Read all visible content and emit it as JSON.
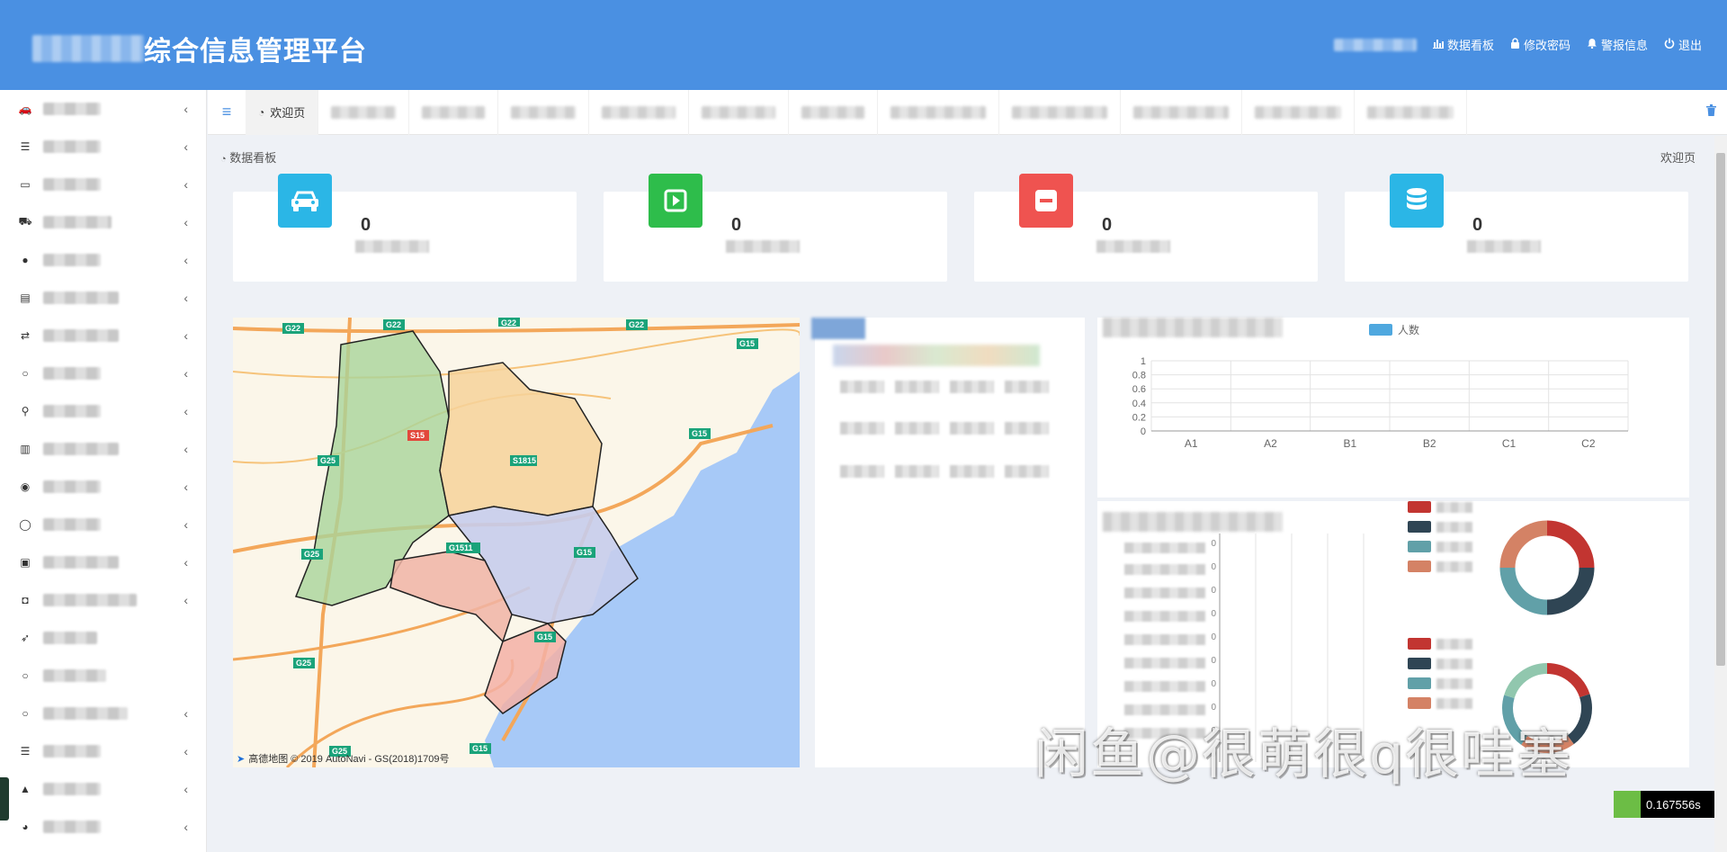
{
  "header": {
    "title": "综合信息管理平台",
    "actions": [
      {
        "label": "数据看板",
        "icon": "bar-chart-icon"
      },
      {
        "label": "修改密码",
        "icon": "lock-icon"
      },
      {
        "label": "警报信息",
        "icon": "bell-icon"
      },
      {
        "label": "退出",
        "icon": "power-icon"
      }
    ]
  },
  "tabs": {
    "active_label": "欢迎页"
  },
  "breadcrumb": {
    "left": "数据看板",
    "right": "欢迎页"
  },
  "stats": [
    {
      "value": "0",
      "icon": "car-icon",
      "color": "#2bb6e6"
    },
    {
      "value": "0",
      "icon": "play-square-icon",
      "color": "#2ebd4b"
    },
    {
      "value": "0",
      "icon": "minus-square-icon",
      "color": "#ef5350"
    },
    {
      "value": "0",
      "icon": "database-icon",
      "color": "#2bb6e6"
    }
  ],
  "map": {
    "credit": "高德地图 © 2019 AutoNavi - GS(2018)1709号",
    "road_labels": [
      "G22",
      "G22",
      "G22",
      "G22",
      "G15",
      "G15",
      "G25",
      "S15",
      "S1815",
      "G1511",
      "G15",
      "G25",
      "G25",
      "G15",
      "G25",
      "G15"
    ]
  },
  "chart_data": {
    "type": "bar",
    "categories": [
      "A1",
      "A2",
      "B1",
      "B2",
      "C1",
      "C2"
    ],
    "series": [
      {
        "name": "人数",
        "values": [
          0,
          0,
          0,
          0,
          0,
          0
        ]
      }
    ],
    "yticks": [
      "0",
      "0.2",
      "0.4",
      "0.6",
      "0.8",
      "1"
    ],
    "ylim": [
      0,
      1
    ],
    "grid": true,
    "legend_position": "top"
  },
  "donut_colors": [
    "#c23531",
    "#2f4554",
    "#61a0a8",
    "#d48265",
    "#91c7ae"
  ],
  "hbar_axis_ticks": [
    "0",
    "0",
    "0",
    "0",
    "0",
    "0",
    "0",
    "0",
    "0",
    "0"
  ],
  "timer": "0.167556s",
  "watermark": "闲鱼@很萌很q很哇塞"
}
